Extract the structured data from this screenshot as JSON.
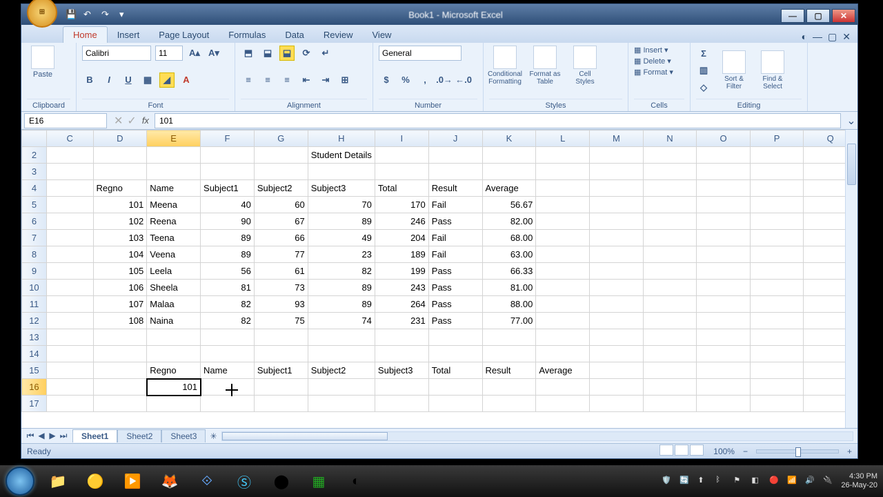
{
  "title": "Book1 - Microsoft Excel",
  "qat": {
    "save": "💾",
    "undo": "↶",
    "redo": "↷"
  },
  "tabs": [
    "Home",
    "Insert",
    "Page Layout",
    "Formulas",
    "Data",
    "Review",
    "View"
  ],
  "active_tab": 0,
  "ribbon": {
    "clipboard": {
      "paste": "Paste",
      "label": "Clipboard"
    },
    "font": {
      "name": "Calibri",
      "size": "11",
      "label": "Font"
    },
    "alignment": {
      "label": "Alignment"
    },
    "number": {
      "format": "General",
      "label": "Number"
    },
    "styles": {
      "conditional": "Conditional Formatting",
      "table": "Format as Table",
      "cell": "Cell Styles",
      "label": "Styles"
    },
    "cells": {
      "insert": "Insert",
      "delete": "Delete",
      "format": "Format",
      "label": "Cells"
    },
    "editing": {
      "sort": "Sort & Filter",
      "find": "Find & Select",
      "label": "Editing"
    }
  },
  "namebox": "E16",
  "formula": "101",
  "columns": [
    "C",
    "D",
    "E",
    "F",
    "G",
    "H",
    "I",
    "J",
    "K",
    "L",
    "M",
    "N",
    "O",
    "P",
    "Q"
  ],
  "active_col_index": 2,
  "rows_start": 2,
  "active_row": 16,
  "title_cell": "Student Details",
  "headers": [
    "Regno",
    "Name",
    "Subject1",
    "Subject2",
    "Subject3",
    "Total",
    "Result",
    "Average"
  ],
  "data_rows": [
    {
      "regno": "101",
      "name": "Meena",
      "s1": "40",
      "s2": "60",
      "s3": "70",
      "total": "170",
      "result": "Fail",
      "avg": "56.67"
    },
    {
      "regno": "102",
      "name": "Reena",
      "s1": "90",
      "s2": "67",
      "s3": "89",
      "total": "246",
      "result": "Pass",
      "avg": "82.00"
    },
    {
      "regno": "103",
      "name": "Teena",
      "s1": "89",
      "s2": "66",
      "s3": "49",
      "total": "204",
      "result": "Fail",
      "avg": "68.00"
    },
    {
      "regno": "104",
      "name": "Veena",
      "s1": "89",
      "s2": "77",
      "s3": "23",
      "total": "189",
      "result": "Fail",
      "avg": "63.00"
    },
    {
      "regno": "105",
      "name": "Leela",
      "s1": "56",
      "s2": "61",
      "s3": "82",
      "total": "199",
      "result": "Pass",
      "avg": "66.33"
    },
    {
      "regno": "106",
      "name": "Sheela",
      "s1": "81",
      "s2": "73",
      "s3": "89",
      "total": "243",
      "result": "Pass",
      "avg": "81.00"
    },
    {
      "regno": "107",
      "name": "Malaa",
      "s1": "82",
      "s2": "93",
      "s3": "89",
      "total": "264",
      "result": "Pass",
      "avg": "88.00"
    },
    {
      "regno": "108",
      "name": "Naina",
      "s1": "82",
      "s2": "75",
      "s3": "74",
      "total": "231",
      "result": "Pass",
      "avg": "77.00"
    }
  ],
  "lookup_headers": [
    "Regno",
    "Name",
    "Subject1",
    "Subject2",
    "Subject3",
    "Total",
    "Result",
    "Average"
  ],
  "lookup_value": "101",
  "sheets": [
    "Sheet1",
    "Sheet2",
    "Sheet3"
  ],
  "active_sheet": 0,
  "status": "Ready",
  "zoom": "100%",
  "clock": {
    "time": "4:30 PM",
    "date": "26-May-20"
  }
}
